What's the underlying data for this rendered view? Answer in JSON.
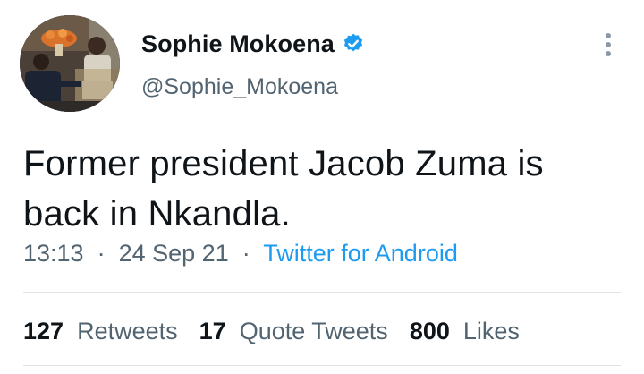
{
  "author": {
    "display_name": "Sophie Mokoena",
    "handle": "@Sophie_Mokoena",
    "verified": true,
    "avatar_icon": "profile-photo"
  },
  "tweet": {
    "text": "Former president Jacob Zuma is back in Nkandla.",
    "time": "13:13",
    "separator": "·",
    "date": "24 Sep 21",
    "source": "Twitter for Android"
  },
  "stats": {
    "retweets_count": "127",
    "retweets_label": "Retweets",
    "quotes_count": "17",
    "quotes_label": "Quote Tweets",
    "likes_count": "800",
    "likes_label": "Likes"
  },
  "colors": {
    "primary_text": "#0f1419",
    "secondary_text": "#536471",
    "accent": "#1d9bf0",
    "divider": "#dfe3e6"
  }
}
